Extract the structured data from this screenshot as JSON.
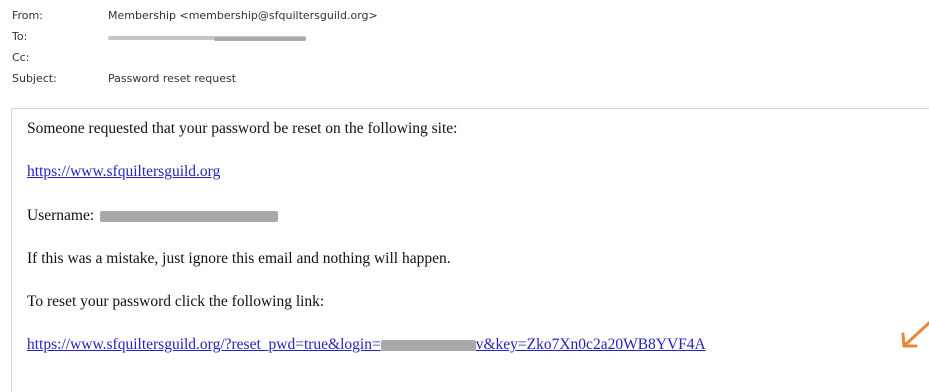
{
  "header": {
    "from_label": "From:",
    "from_value": "Membership <membership@sfquiltersguild.org>",
    "to_label": "To:",
    "cc_label": "Cc:",
    "subject_label": "Subject:",
    "subject_value": "Password reset request"
  },
  "body": {
    "intro": "Someone requested that your password be reset on the following site:",
    "site_link": "https://www.sfquiltersguild.org",
    "username_label": "Username:",
    "mistake_note": "If this was a mistake, just ignore this email and nothing will happen.",
    "reset_instruction": "To reset your password click the following link:",
    "reset_link_prefix": "https://www.sfquiltersguild.org/?reset_pwd=true&login=",
    "reset_link_suffix": "v&key=Zko7Xn0c2a20WB8YVF4A"
  },
  "colors": {
    "link": "#2323c4",
    "redaction": "#a9a9a9",
    "arrow": "#e8873a"
  },
  "icons": {
    "annotation": "orange-arrow-icon"
  }
}
